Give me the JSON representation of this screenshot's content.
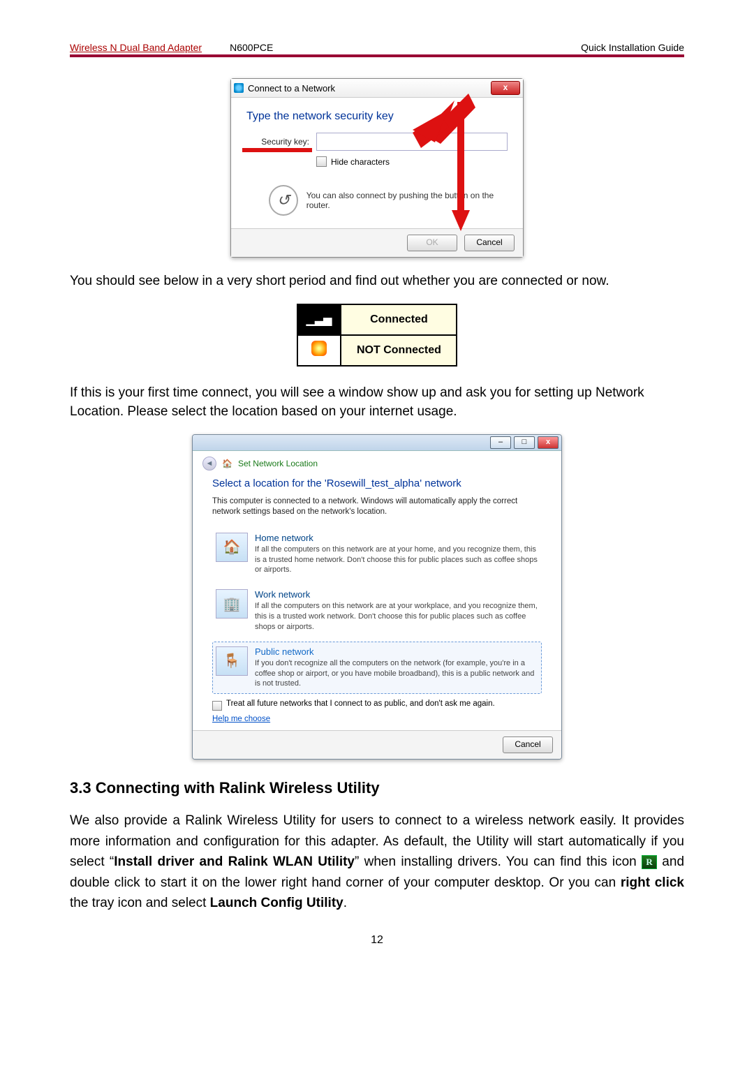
{
  "header": {
    "product": "Wireless N Dual Band Adapter",
    "model": "N600PCE",
    "doc": "Quick Installation Guide"
  },
  "dlg1": {
    "title": "Connect to a Network",
    "close": "x",
    "prompt": "Type the network security key",
    "sec_key_label": "Security key:",
    "sec_key_value": "",
    "hide_label": "Hide characters",
    "wps_text": "You can also connect by pushing the button on the router.",
    "ok": "OK",
    "cancel": "Cancel"
  },
  "para1": "You should see below in a very short period and find out whether you are connected or now.",
  "conn": {
    "connected": "Connected",
    "not_connected": "NOT Connected"
  },
  "para2": "If this is your first time connect, you will see a window show up and ask you for setting up Network Location. Please select the location based on your internet usage.",
  "dlg2": {
    "min": "–",
    "max": "□",
    "close": "x",
    "crumb": "Set Network Location",
    "heading": "Select a location for the 'Rosewill_test_alpha' network",
    "desc": "This computer is connected to a network. Windows will automatically apply the correct network settings based on the network's location.",
    "home": {
      "title": "Home network",
      "desc": "If all the computers on this network are at your home, and you recognize them, this is a trusted home network.  Don't choose this for public places such as coffee shops or airports."
    },
    "work": {
      "title": "Work network",
      "desc": "If all the computers on this network are at your workplace, and you recognize them, this is a trusted work network.  Don't choose this for public places such as coffee shops or airports."
    },
    "public": {
      "title": "Public network",
      "desc": "If you don't recognize all the computers on the network (for example, you're in a coffee shop or airport, or you have mobile broadband), this is a public network and is not trusted."
    },
    "treat": "Treat all future networks that I connect to as public, and don't ask me again.",
    "help": "Help me choose",
    "cancel": "Cancel"
  },
  "section33": {
    "heading": "3.3 Connecting with Ralink Wireless Utility",
    "p_a": "We also provide a Ralink Wireless Utility for users to connect to a wireless network easily. It provides more information and configuration for this adapter. As default, the Utility will start automatically if you select “",
    "p_b_bold": "Install driver and Ralink WLAN Utility",
    "p_c": "” when installing drivers. You can find this icon ",
    "p_d": " and double click to start it on the lower right hand corner of your computer desktop. Or you can ",
    "p_e_bold": "right click",
    "p_f": " the tray icon and select ",
    "p_g_bold": "Launch Config Utility",
    "p_h": "."
  },
  "page_num": "12"
}
